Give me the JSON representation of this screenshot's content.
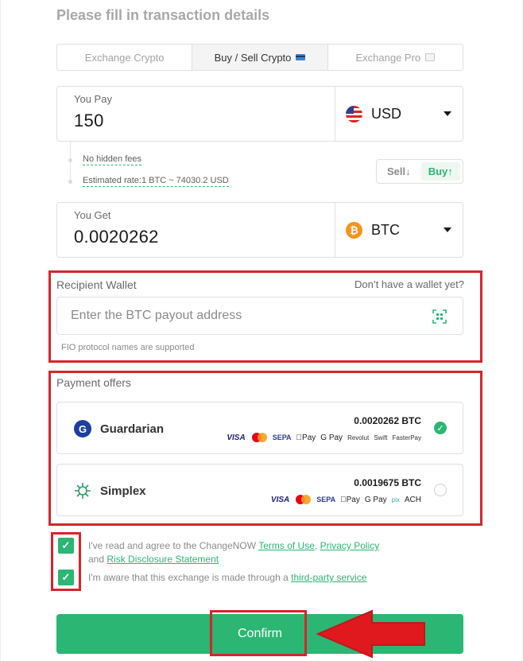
{
  "header": {
    "title": "Please fill in transaction details"
  },
  "tabs": [
    {
      "label": "Exchange Crypto",
      "active": false
    },
    {
      "label": "Buy / Sell Crypto",
      "active": true,
      "icon": "credit-card-icon"
    },
    {
      "label": "Exchange Pro",
      "active": false,
      "icon": "chart-icon"
    }
  ],
  "pay": {
    "label": "You Pay",
    "value": "150",
    "currency": "USD",
    "currency_icon": "us-flag-icon"
  },
  "info": {
    "fees": "No hidden fees",
    "rate": "Estimated rate:1 BTC ~ 74030.2 USD"
  },
  "toggle": {
    "sell": "Sell",
    "buy": "Buy",
    "selected": "buy"
  },
  "get": {
    "label": "You Get",
    "value": "0.0020262",
    "currency": "BTC",
    "currency_icon": "bitcoin-icon"
  },
  "wallet": {
    "label": "Recipient Wallet",
    "no_wallet_link": "Don’t have a wallet yet?",
    "placeholder": "Enter the BTC payout address",
    "hint": "FIO protocol names are supported"
  },
  "payment": {
    "label": "Payment offers",
    "offers": [
      {
        "name": "Guardarian",
        "amount": "0.0020262 BTC",
        "selected": true,
        "methods": [
          "VISA",
          "Mastercard",
          "SEPA",
          "Apple Pay",
          "G Pay",
          "Revolut",
          "Swift",
          "FasterPay"
        ]
      },
      {
        "name": "Simplex",
        "amount": "0.0019675 BTC",
        "selected": false,
        "methods": [
          "VISA",
          "Mastercard",
          "SEPA",
          "Apple Pay",
          "G Pay",
          "pix",
          "ACH"
        ]
      }
    ]
  },
  "agreements": {
    "terms_prefix": "I've read and agree to the ChangeNOW",
    "terms_link": "Terms of Use",
    "privacy_link": "Privacy Policy",
    "and": "and",
    "risk_link": "Risk Disclosure Statement",
    "third_party_prefix": "I'm aware that this exchange is made through a",
    "third_party_link": "third-party service",
    "checked": true
  },
  "confirm": {
    "label": "Confirm"
  },
  "colors": {
    "accent": "#2bb673",
    "highlight": "#d8242c"
  }
}
